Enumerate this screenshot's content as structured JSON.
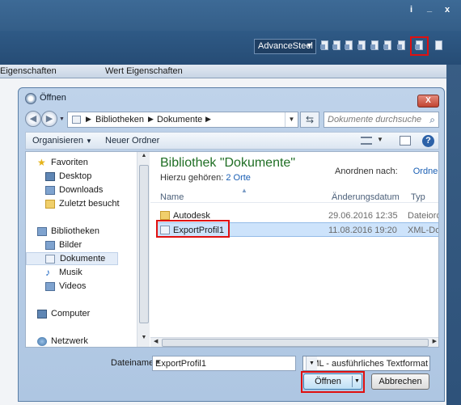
{
  "app": {
    "window_buttons": [
      "i",
      "_",
      "x"
    ],
    "profile_dropdown": "AdvanceSteel",
    "toolbar_icons": [
      "export-profile-icon-1",
      "export-profile-icon-2",
      "export-profile-icon-3",
      "export-profile-icon-4",
      "export-profile-icon-5",
      "export-profile-icon-6",
      "export-profile-icon-7",
      "import-profile-icon",
      "export-icon"
    ],
    "properties_header": {
      "left": "Eigenschaften",
      "right": "Wert Eigenschaften"
    }
  },
  "dialog": {
    "title": "Öffnen",
    "close_label": "X",
    "breadcrumb": [
      "Bibliotheken",
      "Dokumente"
    ],
    "search_placeholder": "Dokumente durchsuchen",
    "commands": {
      "organize": "Organisieren",
      "new_folder": "Neuer Ordner"
    },
    "nav": {
      "favorites": "Favoriten",
      "favorites_items": [
        "Desktop",
        "Downloads",
        "Zuletzt besucht"
      ],
      "libraries": "Bibliotheken",
      "library_items": [
        "Bilder",
        "Dokumente",
        "Musik",
        "Videos"
      ],
      "selected": "Dokumente",
      "computer": "Computer",
      "network": "Netzwerk"
    },
    "library_title": "Bibliothek \"Dokumente\"",
    "library_sub_prefix": "Hierzu gehören:",
    "library_sub_link": "2 Orte",
    "arrange_label": "Anordnen nach:",
    "arrange_value": "Ordner",
    "columns": {
      "name": "Name",
      "date": "Änderungsdatum",
      "type": "Typ"
    },
    "files": [
      {
        "name": "Autodesk",
        "date": "29.06.2016 12:35",
        "type": "Dateiordner",
        "kind": "folder"
      },
      {
        "name": "ExportProfil1",
        "date": "11.08.2016 19:20",
        "type": "XML-Dokument",
        "kind": "xml"
      }
    ],
    "filename_label": "Dateiname:",
    "filename_value": "ExportProfil1",
    "filetype_value": "XML - ausführliches Textformat",
    "open_button": "Öffnen",
    "cancel_button": "Abbrechen"
  },
  "colors": {
    "highlight_red": "#e01010",
    "library_title_green": "#1f6e24",
    "link_blue": "#1a5fb4"
  }
}
